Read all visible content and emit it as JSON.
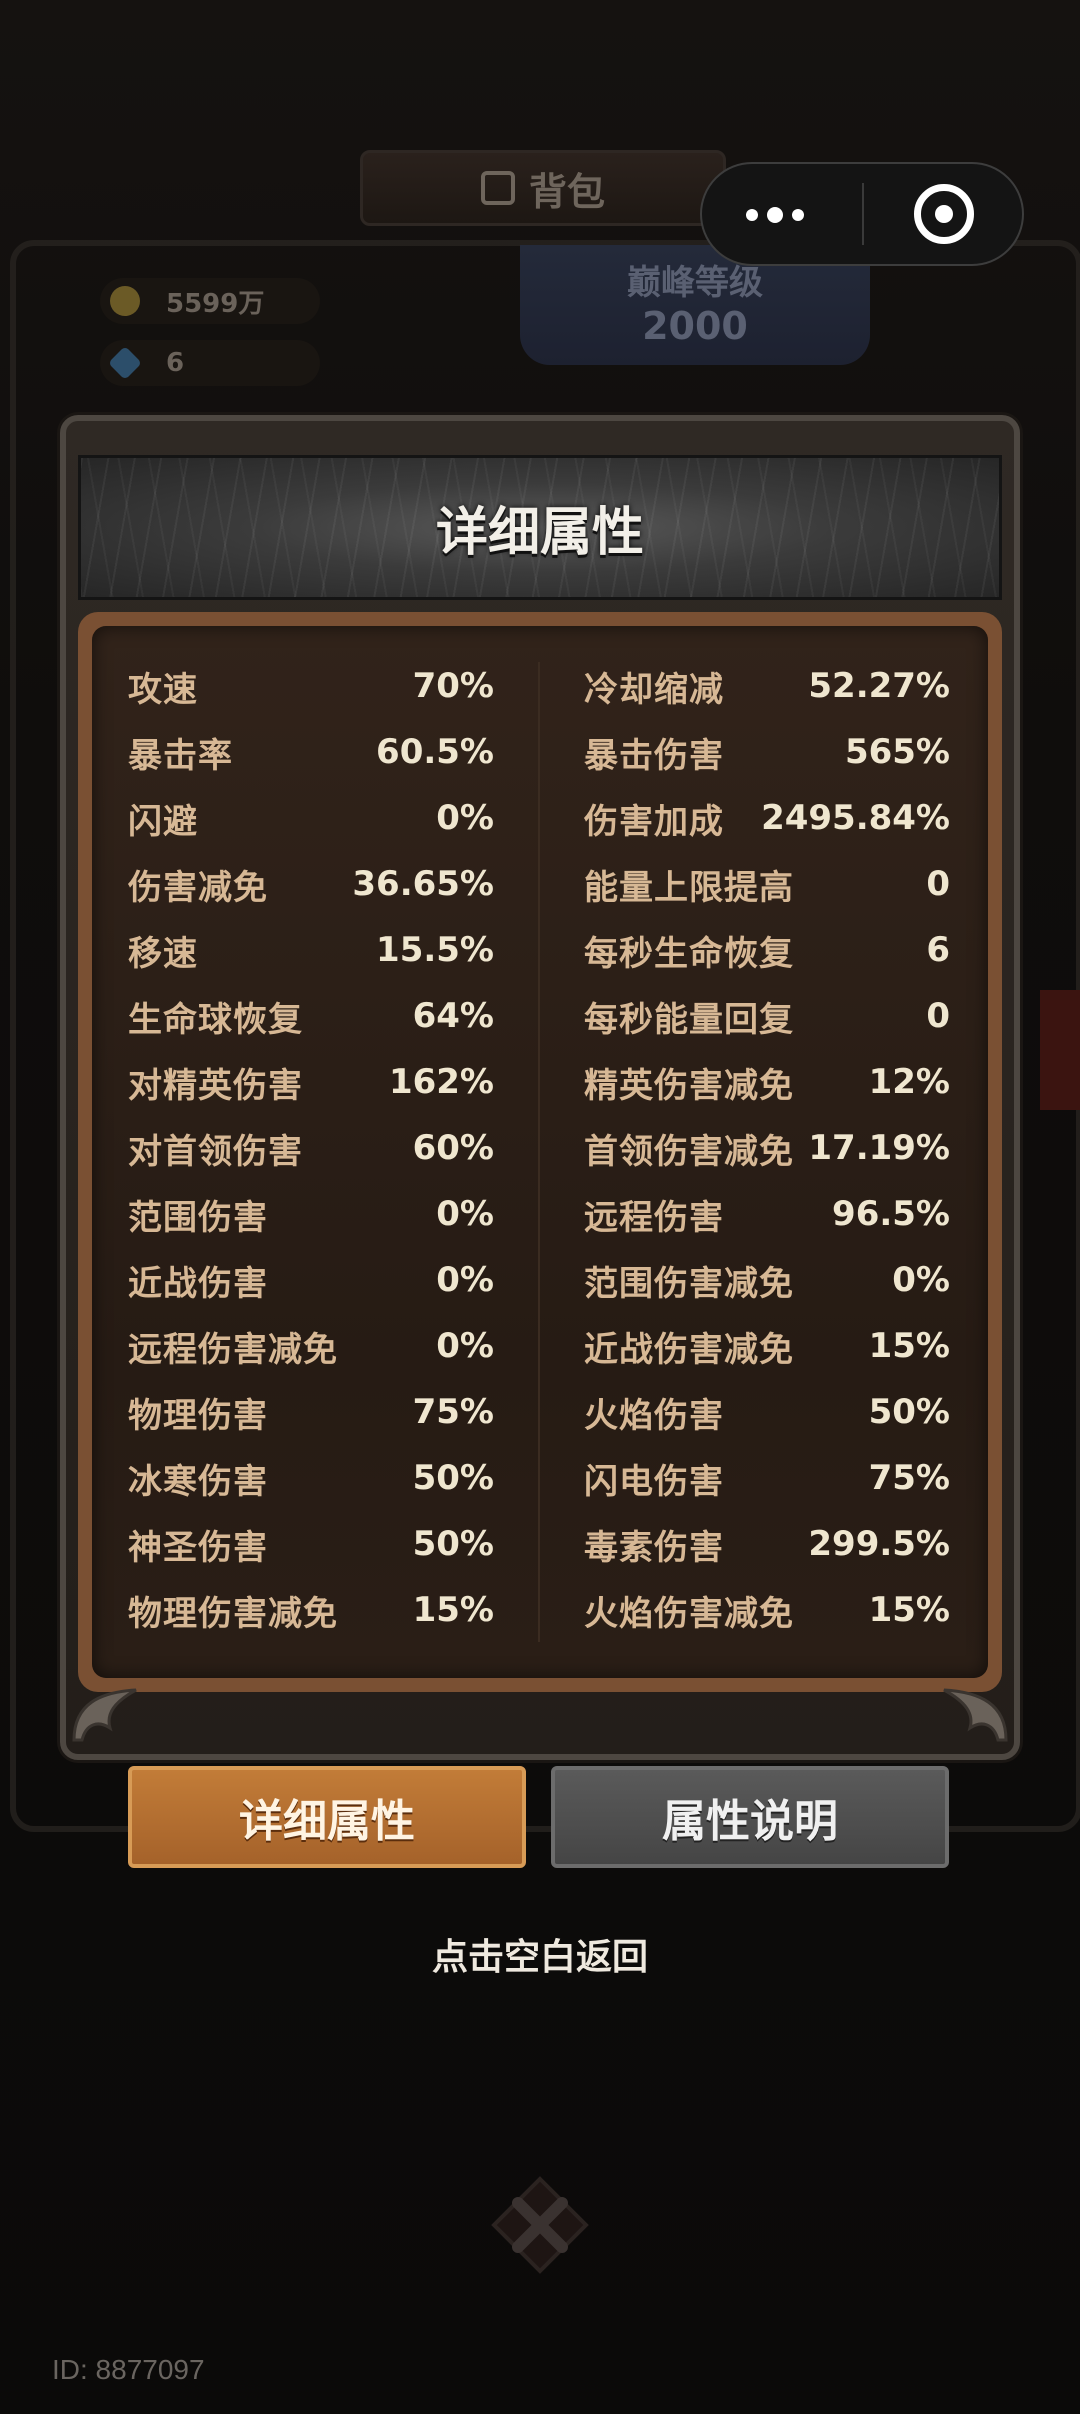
{
  "background": {
    "bag_tab_label": "背包",
    "gold_amount": "5599万",
    "gem_amount": "6",
    "peak_level_label": "巅峰等级",
    "peak_level_value": "2000"
  },
  "capsule_menu": {
    "more_icon": "more-dots-icon",
    "close_icon": "target-circle-icon"
  },
  "panel": {
    "title": "详细属性",
    "stats_left": [
      {
        "label": "攻速",
        "value": "70%"
      },
      {
        "label": "暴击率",
        "value": "60.5%"
      },
      {
        "label": "闪避",
        "value": "0%"
      },
      {
        "label": "伤害减免",
        "value": "36.65%"
      },
      {
        "label": "移速",
        "value": "15.5%"
      },
      {
        "label": "生命球恢复",
        "value": "64%"
      },
      {
        "label": "对精英伤害",
        "value": "162%"
      },
      {
        "label": "对首领伤害",
        "value": "60%"
      },
      {
        "label": "范围伤害",
        "value": "0%"
      },
      {
        "label": "近战伤害",
        "value": "0%"
      },
      {
        "label": "远程伤害减免",
        "value": "0%"
      },
      {
        "label": "物理伤害",
        "value": "75%"
      },
      {
        "label": "冰寒伤害",
        "value": "50%"
      },
      {
        "label": "神圣伤害",
        "value": "50%"
      },
      {
        "label": "物理伤害减免",
        "value": "15%"
      }
    ],
    "stats_right": [
      {
        "label": "冷却缩减",
        "value": "52.27%"
      },
      {
        "label": "暴击伤害",
        "value": "565%"
      },
      {
        "label": "伤害加成",
        "value": "2495.84%"
      },
      {
        "label": "能量上限提高",
        "value": "0"
      },
      {
        "label": "每秒生命恢复",
        "value": "6"
      },
      {
        "label": "每秒能量回复",
        "value": "0"
      },
      {
        "label": "精英伤害减免",
        "value": "12%"
      },
      {
        "label": "首领伤害减免",
        "value": "17.19%"
      },
      {
        "label": "远程伤害",
        "value": "96.5%"
      },
      {
        "label": "范围伤害减免",
        "value": "0%"
      },
      {
        "label": "近战伤害减免",
        "value": "15%"
      },
      {
        "label": "火焰伤害",
        "value": "50%"
      },
      {
        "label": "闪电伤害",
        "value": "75%"
      },
      {
        "label": "毒素伤害",
        "value": "299.5%"
      },
      {
        "label": "火焰伤害减免",
        "value": "15%"
      }
    ]
  },
  "tabs": {
    "detail_label": "详细属性",
    "explain_label": "属性说明"
  },
  "hint": "点击空白返回",
  "footer_id": "ID: 8877097",
  "colors": {
    "accent_orange": "#b36d30",
    "label_tan": "#d7b895",
    "value_cream": "#efe6cf"
  }
}
